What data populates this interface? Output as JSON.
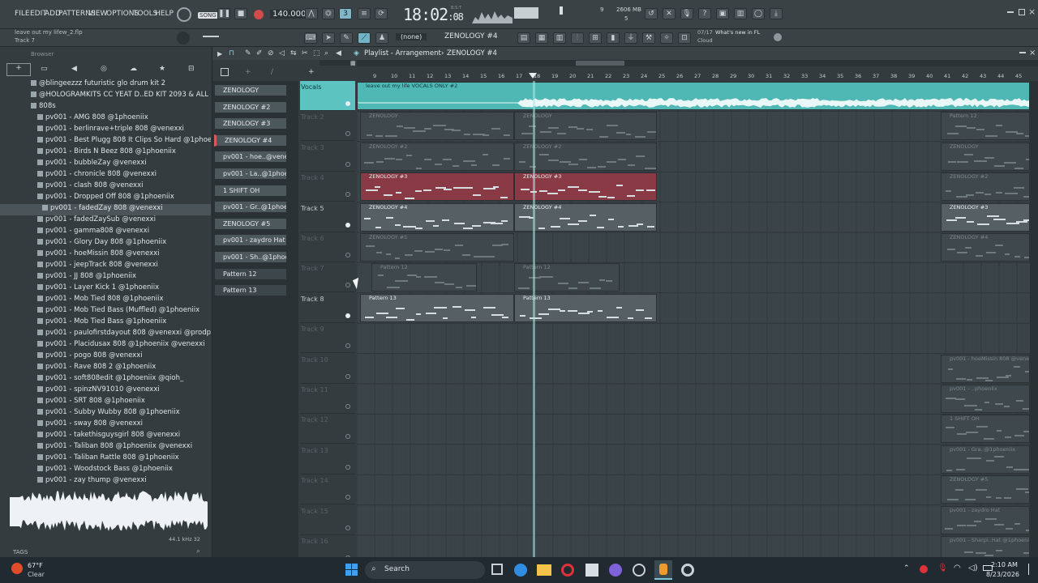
{
  "topbar": {
    "menu": [
      "FILE",
      "EDIT",
      "ADD",
      "PATTERNS",
      "VIEW",
      "OPTIONS",
      "TOOLS",
      "HELP"
    ],
    "song_label": "SONG",
    "tempo": "140.000",
    "time": "18:02",
    "time_small": ":08",
    "time_unit": "B:S:T",
    "cpu_value": "9",
    "memory": "2606 MB",
    "memory_sub": "5"
  },
  "secondbar": {
    "project_hint": "leave out my lifew_2.flp",
    "track_hint": "Track 7",
    "pattern_none": "(none)",
    "pattern_selected": "ZENOLOGY #4",
    "news_count": "07/17",
    "news_text": "What's new in FL",
    "news_sub": "Cloud"
  },
  "browser": {
    "title": "Browser",
    "folders": [
      "@blingeezzz futuristic glo drum kit 2",
      "@HOLOGRAMKITS CC YEAT D..ED KIT 2093 & ALL ALBUMS",
      "808s"
    ],
    "files": [
      "pv001 - AMG 808 @1phoeniix",
      "pv001 - berlinrave+triple 808 @venexxi",
      "pv001 - Best Plugg 808 It Clips So Hard @1phoeniix",
      "pv001 - Birds N Beez 808 @1phoeniix",
      "pv001 - bubbleZay @venexxi",
      "pv001 - chronicle 808 @venexxi",
      "pv001 - clash 808 @venexxi",
      "pv001 - Dropped Off 808 @1phoeniix",
      "pv001 - fadedZay 808 @venexxi",
      "pv001 - fadedZaySub @venexxi",
      "pv001 - gamma808 @venexxi",
      "pv001 - Glory Day 808 @1phoeniix",
      "pv001 - hoeMissin 808 @venexxi",
      "pv001 - jeepTrack 808 @venexxi",
      "pv001 - JJ 808 @1phoeniix",
      "pv001 - Layer Kick 1 @1phoeniix",
      "pv001 - Mob Tied 808 @1phoeniix",
      "pv001 - Mob Tied Bass (Muffled) @1phoeniix",
      "pv001 - Mob Tied Bass @1phoeniix",
      "pv001 - paulofirstdayout 808 @venexxi @prodpaulo",
      "pv001 - Placidusax 808 @1phoeniix @venexxi",
      "pv001 - pogo 808 @venexxi",
      "pv001 - Rave 808 2 @1phoeniix",
      "pv001 - soft808edit @1phoeniix @qioh_",
      "pv001 - spinzNV91010 @venexxi",
      "pv001 - SRT 808 @1phoeniix",
      "pv001 - Subby Wubby 808 @1phoeniix",
      "pv001 - sway 808 @venexxi",
      "pv001 - takethisguysgirl 808 @venexxi",
      "pv001 - Taliban 808 @1phoeniix @venexxi",
      "pv001 - Taliban Rattle 808 @1phoeniix",
      "pv001 - Woodstock Bass @1phoeniix",
      "pv001 - zay thump @venexxi"
    ],
    "selected_index": 8,
    "sample_rate": "44.1 kHz 32",
    "tags_label": "TAGS"
  },
  "playlist": {
    "title": "Playlist - Arrangement",
    "pattern": "ZENOLOGY #4",
    "patterns": [
      "ZENOLOGY",
      "ZENOLOGY #2",
      "ZENOLOGY #3",
      "ZENOLOGY #4",
      "pv001 - hoe..@venexxi",
      "pv001 - La..@1phoeniix",
      "1 SHIFT OH",
      "pv001 - Gr..@1phoeniix",
      "ZENOLOGY #5",
      "pv001 - zaydro Hat",
      "pv001 - Sh..@1phoeniix",
      "Pattern 12",
      "Pattern 13"
    ],
    "tracks": [
      "Vocals",
      "Track 2",
      "Track 3",
      "Track 4",
      "Track 5",
      "Track 6",
      "Track 7",
      "Track 8",
      "Track 9",
      "Track 10",
      "Track 11",
      "Track 12",
      "Track 13",
      "Track 14",
      "Track 15",
      "Track 16"
    ],
    "bars": [
      "9",
      "10",
      "11",
      "12",
      "13",
      "14",
      "15",
      "16",
      "17",
      "18",
      "19",
      "20",
      "21",
      "22",
      "23",
      "24",
      "25",
      "26",
      "27",
      "28",
      "29",
      "30",
      "31",
      "32",
      "33",
      "34",
      "35",
      "36",
      "37",
      "38",
      "39",
      "40",
      "41",
      "42",
      "43",
      "44",
      "45"
    ],
    "audio_clip": "leave out my life VOCALS ONLY #2",
    "clip_labels": {
      "t2": "ZENOLOGY",
      "t3": "ZENOLOGY #2",
      "t4": "ZENOLOGY #3",
      "t5": "ZENOLOGY #4",
      "t6": "ZENOLOGY #5",
      "t7": "Pattern 12",
      "t8": "Pattern 13",
      "r2": "Pattern 12",
      "r3": "ZENOLOGY",
      "r4": "ZENOLOGY #2",
      "r5": "ZENOLOGY #3",
      "r6": "ZENOLOGY #4",
      "r10": "pv001 - hoeMissin 808 @venexxi",
      "r11": "pv001 - ..phoeniix",
      "r12": "1 SHIFT OH",
      "r13": "pv001 - Gra..@1phoeniix",
      "r14": "ZENOLOGY #5",
      "r15": "pv001 - zaydro Hat",
      "r16": "pv001 - Sharpi..Hat @1phoeniix"
    }
  },
  "taskbar": {
    "weather_temp": "67°F",
    "weather_desc": "Clear",
    "search": "Search",
    "time": "2:10 AM",
    "date": "8/23/2026"
  }
}
